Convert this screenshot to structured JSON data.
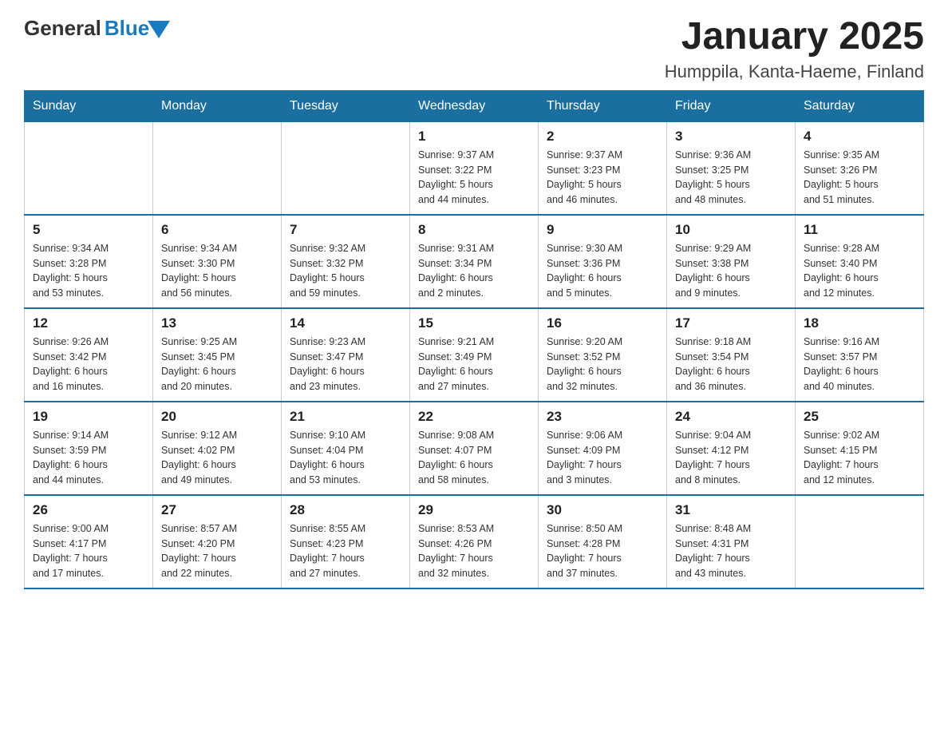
{
  "logo": {
    "general": "General",
    "blue": "Blue"
  },
  "header": {
    "title": "January 2025",
    "subtitle": "Humppila, Kanta-Haeme, Finland"
  },
  "weekdays": [
    "Sunday",
    "Monday",
    "Tuesday",
    "Wednesday",
    "Thursday",
    "Friday",
    "Saturday"
  ],
  "weeks": [
    [
      {
        "day": "",
        "info": ""
      },
      {
        "day": "",
        "info": ""
      },
      {
        "day": "",
        "info": ""
      },
      {
        "day": "1",
        "info": "Sunrise: 9:37 AM\nSunset: 3:22 PM\nDaylight: 5 hours\nand 44 minutes."
      },
      {
        "day": "2",
        "info": "Sunrise: 9:37 AM\nSunset: 3:23 PM\nDaylight: 5 hours\nand 46 minutes."
      },
      {
        "day": "3",
        "info": "Sunrise: 9:36 AM\nSunset: 3:25 PM\nDaylight: 5 hours\nand 48 minutes."
      },
      {
        "day": "4",
        "info": "Sunrise: 9:35 AM\nSunset: 3:26 PM\nDaylight: 5 hours\nand 51 minutes."
      }
    ],
    [
      {
        "day": "5",
        "info": "Sunrise: 9:34 AM\nSunset: 3:28 PM\nDaylight: 5 hours\nand 53 minutes."
      },
      {
        "day": "6",
        "info": "Sunrise: 9:34 AM\nSunset: 3:30 PM\nDaylight: 5 hours\nand 56 minutes."
      },
      {
        "day": "7",
        "info": "Sunrise: 9:32 AM\nSunset: 3:32 PM\nDaylight: 5 hours\nand 59 minutes."
      },
      {
        "day": "8",
        "info": "Sunrise: 9:31 AM\nSunset: 3:34 PM\nDaylight: 6 hours\nand 2 minutes."
      },
      {
        "day": "9",
        "info": "Sunrise: 9:30 AM\nSunset: 3:36 PM\nDaylight: 6 hours\nand 5 minutes."
      },
      {
        "day": "10",
        "info": "Sunrise: 9:29 AM\nSunset: 3:38 PM\nDaylight: 6 hours\nand 9 minutes."
      },
      {
        "day": "11",
        "info": "Sunrise: 9:28 AM\nSunset: 3:40 PM\nDaylight: 6 hours\nand 12 minutes."
      }
    ],
    [
      {
        "day": "12",
        "info": "Sunrise: 9:26 AM\nSunset: 3:42 PM\nDaylight: 6 hours\nand 16 minutes."
      },
      {
        "day": "13",
        "info": "Sunrise: 9:25 AM\nSunset: 3:45 PM\nDaylight: 6 hours\nand 20 minutes."
      },
      {
        "day": "14",
        "info": "Sunrise: 9:23 AM\nSunset: 3:47 PM\nDaylight: 6 hours\nand 23 minutes."
      },
      {
        "day": "15",
        "info": "Sunrise: 9:21 AM\nSunset: 3:49 PM\nDaylight: 6 hours\nand 27 minutes."
      },
      {
        "day": "16",
        "info": "Sunrise: 9:20 AM\nSunset: 3:52 PM\nDaylight: 6 hours\nand 32 minutes."
      },
      {
        "day": "17",
        "info": "Sunrise: 9:18 AM\nSunset: 3:54 PM\nDaylight: 6 hours\nand 36 minutes."
      },
      {
        "day": "18",
        "info": "Sunrise: 9:16 AM\nSunset: 3:57 PM\nDaylight: 6 hours\nand 40 minutes."
      }
    ],
    [
      {
        "day": "19",
        "info": "Sunrise: 9:14 AM\nSunset: 3:59 PM\nDaylight: 6 hours\nand 44 minutes."
      },
      {
        "day": "20",
        "info": "Sunrise: 9:12 AM\nSunset: 4:02 PM\nDaylight: 6 hours\nand 49 minutes."
      },
      {
        "day": "21",
        "info": "Sunrise: 9:10 AM\nSunset: 4:04 PM\nDaylight: 6 hours\nand 53 minutes."
      },
      {
        "day": "22",
        "info": "Sunrise: 9:08 AM\nSunset: 4:07 PM\nDaylight: 6 hours\nand 58 minutes."
      },
      {
        "day": "23",
        "info": "Sunrise: 9:06 AM\nSunset: 4:09 PM\nDaylight: 7 hours\nand 3 minutes."
      },
      {
        "day": "24",
        "info": "Sunrise: 9:04 AM\nSunset: 4:12 PM\nDaylight: 7 hours\nand 8 minutes."
      },
      {
        "day": "25",
        "info": "Sunrise: 9:02 AM\nSunset: 4:15 PM\nDaylight: 7 hours\nand 12 minutes."
      }
    ],
    [
      {
        "day": "26",
        "info": "Sunrise: 9:00 AM\nSunset: 4:17 PM\nDaylight: 7 hours\nand 17 minutes."
      },
      {
        "day": "27",
        "info": "Sunrise: 8:57 AM\nSunset: 4:20 PM\nDaylight: 7 hours\nand 22 minutes."
      },
      {
        "day": "28",
        "info": "Sunrise: 8:55 AM\nSunset: 4:23 PM\nDaylight: 7 hours\nand 27 minutes."
      },
      {
        "day": "29",
        "info": "Sunrise: 8:53 AM\nSunset: 4:26 PM\nDaylight: 7 hours\nand 32 minutes."
      },
      {
        "day": "30",
        "info": "Sunrise: 8:50 AM\nSunset: 4:28 PM\nDaylight: 7 hours\nand 37 minutes."
      },
      {
        "day": "31",
        "info": "Sunrise: 8:48 AM\nSunset: 4:31 PM\nDaylight: 7 hours\nand 43 minutes."
      },
      {
        "day": "",
        "info": ""
      }
    ]
  ]
}
